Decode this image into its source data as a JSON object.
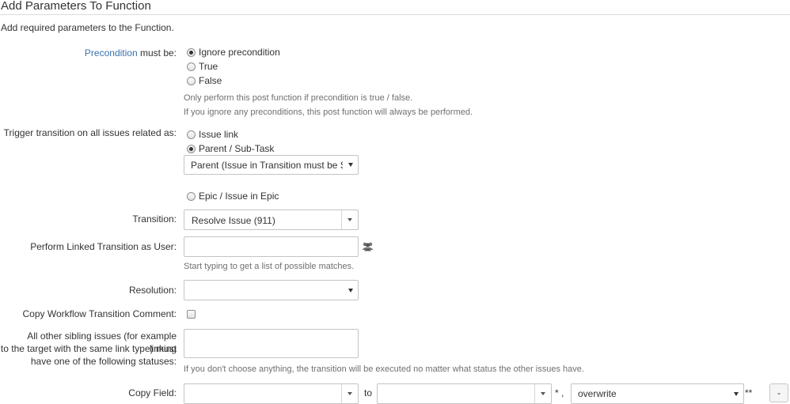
{
  "header": {
    "title": "Add Parameters To Function",
    "description": "Add required parameters to the Function."
  },
  "precondition": {
    "label_link": "Precondition",
    "label_rest": " must be:",
    "options": [
      "Ignore precondition",
      "True",
      "False"
    ],
    "selected": "Ignore precondition",
    "help1": "Only perform this post function if precondition is true / false.",
    "help2": "If you ignore any preconditions, this post function will always be performed."
  },
  "trigger": {
    "label": "Trigger transition on all issues related as:",
    "option_issue_link": "Issue link",
    "option_parent": "Parent / Sub-Task",
    "parent_select_value": "Parent (Issue in Transition must be Su",
    "option_epic": "Epic / Issue in Epic",
    "selected": "Parent / Sub-Task"
  },
  "transition": {
    "label": "Transition:",
    "value": "Resolve Issue (911)"
  },
  "linked_user": {
    "label": "Perform Linked Transition as User:",
    "value": "",
    "help": "Start typing to get a list of possible matches."
  },
  "resolution": {
    "label": "Resolution:",
    "value": ""
  },
  "copy_comment": {
    "label": "Copy Workflow Transition Comment:",
    "checked": false
  },
  "sibling": {
    "label_line1": "All other sibling issues (for example linking",
    "label_line2": "to the target with the same link type) must",
    "label_line3": "have one of the following statuses:",
    "help": "If you don't choose anything, the transition will be executed no matter what status the other issues have."
  },
  "copy_field": {
    "label": "Copy Field:",
    "to_text": "to",
    "asterisk": "* ,",
    "mode_value": "overwrite",
    "double_asterisk": "**",
    "remove_button": "-"
  }
}
